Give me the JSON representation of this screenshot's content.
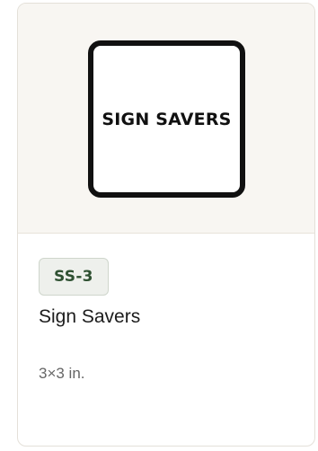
{
  "product": {
    "image_text": "SIGN SAVERS",
    "sku": "SS-3",
    "name": "Sign Savers",
    "size": "3×3 in."
  }
}
